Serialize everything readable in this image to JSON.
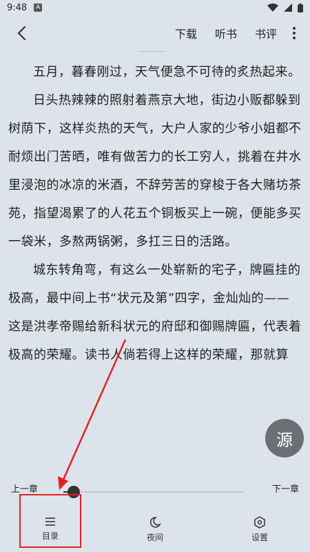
{
  "status_bar": {
    "time": "9:48",
    "notification_icon": "A"
  },
  "toolbar": {
    "download": "下载",
    "listen": "听书",
    "review": "书评"
  },
  "content": {
    "paragraphs": [
      "五月，暮春刚过，天气便急不可待的炙热起来。",
      "日头热辣辣的照射着燕京大地，街边小贩都躲到树荫下，这样炎热的天气，大户人家的少爷小姐都不耐烦出门苦晒，唯有做苦力的长工穷人，挑着在井水里浸泡的冰凉的米酒，不辞劳苦的穿梭于各大赌坊茶苑，指望渴累了的人花五个铜板买上一碗，便能多买一袋米，多熬两锅粥，多扛三日的活路。",
      "城东转角弯，有这么一处崭新的宅子，牌匾挂的极高，最中间上书“状元及第”四字，金灿灿的——这是洪孝帝赐给新科状元的府邸和御赐牌匾，代表着极高的荣耀。读书人倘若得上这样的荣耀，那就算"
    ]
  },
  "fab": {
    "label": "源"
  },
  "chapter_nav": {
    "prev": "上一章",
    "next": "下一章",
    "progress": 0.03
  },
  "tabs": {
    "toc": "目录",
    "night": "夜间",
    "settings": "设置"
  },
  "colors": {
    "background": "#dde3ea",
    "annotation": "#e12323"
  }
}
